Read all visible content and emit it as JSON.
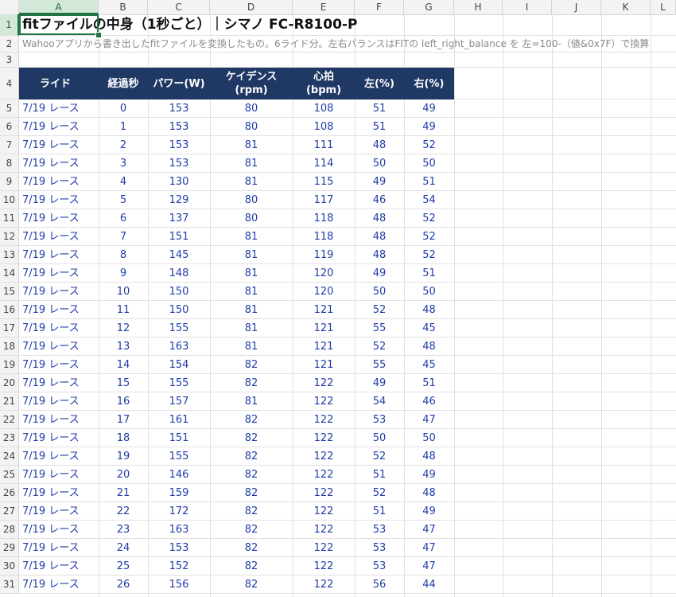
{
  "columns": [
    "A",
    "B",
    "C",
    "D",
    "E",
    "F",
    "G",
    "H",
    "I",
    "J",
    "K",
    "L"
  ],
  "selected_cell": "A1",
  "title": "fitファイルの中身（1秒ごと）｜シマノ FC-R8100-P",
  "subtitle": "Wahooアプリから書き出したfitファイルを変換したもの。6ライド分。左右バランスはFITの left_right_balance を 左=100-（値&0x7F）で換算",
  "table": {
    "headers": [
      [
        "ライド"
      ],
      [
        "経過秒"
      ],
      [
        "パワー(W)"
      ],
      [
        "ケイデンス",
        "(rpm)"
      ],
      [
        "心拍",
        "(bpm)"
      ],
      [
        "左(%)"
      ],
      [
        "右(%)"
      ]
    ],
    "rows": [
      [
        "7/19 レース",
        "0",
        "153",
        "80",
        "108",
        "51",
        "49"
      ],
      [
        "7/19 レース",
        "1",
        "153",
        "80",
        "108",
        "51",
        "49"
      ],
      [
        "7/19 レース",
        "2",
        "153",
        "81",
        "111",
        "48",
        "52"
      ],
      [
        "7/19 レース",
        "3",
        "153",
        "81",
        "114",
        "50",
        "50"
      ],
      [
        "7/19 レース",
        "4",
        "130",
        "81",
        "115",
        "49",
        "51"
      ],
      [
        "7/19 レース",
        "5",
        "129",
        "80",
        "117",
        "46",
        "54"
      ],
      [
        "7/19 レース",
        "6",
        "137",
        "80",
        "118",
        "48",
        "52"
      ],
      [
        "7/19 レース",
        "7",
        "151",
        "81",
        "118",
        "48",
        "52"
      ],
      [
        "7/19 レース",
        "8",
        "145",
        "81",
        "119",
        "48",
        "52"
      ],
      [
        "7/19 レース",
        "9",
        "148",
        "81",
        "120",
        "49",
        "51"
      ],
      [
        "7/19 レース",
        "10",
        "150",
        "81",
        "120",
        "50",
        "50"
      ],
      [
        "7/19 レース",
        "11",
        "150",
        "81",
        "121",
        "52",
        "48"
      ],
      [
        "7/19 レース",
        "12",
        "155",
        "81",
        "121",
        "55",
        "45"
      ],
      [
        "7/19 レース",
        "13",
        "163",
        "81",
        "121",
        "52",
        "48"
      ],
      [
        "7/19 レース",
        "14",
        "154",
        "82",
        "121",
        "55",
        "45"
      ],
      [
        "7/19 レース",
        "15",
        "155",
        "82",
        "122",
        "49",
        "51"
      ],
      [
        "7/19 レース",
        "16",
        "157",
        "81",
        "122",
        "54",
        "46"
      ],
      [
        "7/19 レース",
        "17",
        "161",
        "82",
        "122",
        "53",
        "47"
      ],
      [
        "7/19 レース",
        "18",
        "151",
        "82",
        "122",
        "50",
        "50"
      ],
      [
        "7/19 レース",
        "19",
        "155",
        "82",
        "122",
        "52",
        "48"
      ],
      [
        "7/19 レース",
        "20",
        "146",
        "82",
        "122",
        "51",
        "49"
      ],
      [
        "7/19 レース",
        "21",
        "159",
        "82",
        "122",
        "52",
        "48"
      ],
      [
        "7/19 レース",
        "22",
        "172",
        "82",
        "122",
        "51",
        "49"
      ],
      [
        "7/19 レース",
        "23",
        "163",
        "82",
        "122",
        "53",
        "47"
      ],
      [
        "7/19 レース",
        "24",
        "153",
        "82",
        "122",
        "53",
        "47"
      ],
      [
        "7/19 レース",
        "25",
        "152",
        "82",
        "122",
        "53",
        "47"
      ],
      [
        "7/19 レース",
        "26",
        "156",
        "82",
        "122",
        "56",
        "44"
      ]
    ]
  },
  "colors": {
    "header_bg": "#1f3864",
    "data_text": "#1f3ca8",
    "selection": "#217346"
  }
}
